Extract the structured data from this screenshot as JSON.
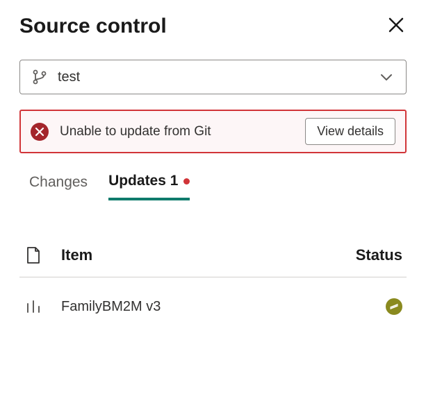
{
  "header": {
    "title": "Source control"
  },
  "dropdown": {
    "label": "test"
  },
  "alert": {
    "message": "Unable to update from Git",
    "button": "View details"
  },
  "tabs": {
    "changes": "Changes",
    "updates": "Updates 1"
  },
  "table": {
    "headers": {
      "item": "Item",
      "status": "Status"
    },
    "rows": [
      {
        "name": "FamilyBM2M v3"
      }
    ]
  }
}
